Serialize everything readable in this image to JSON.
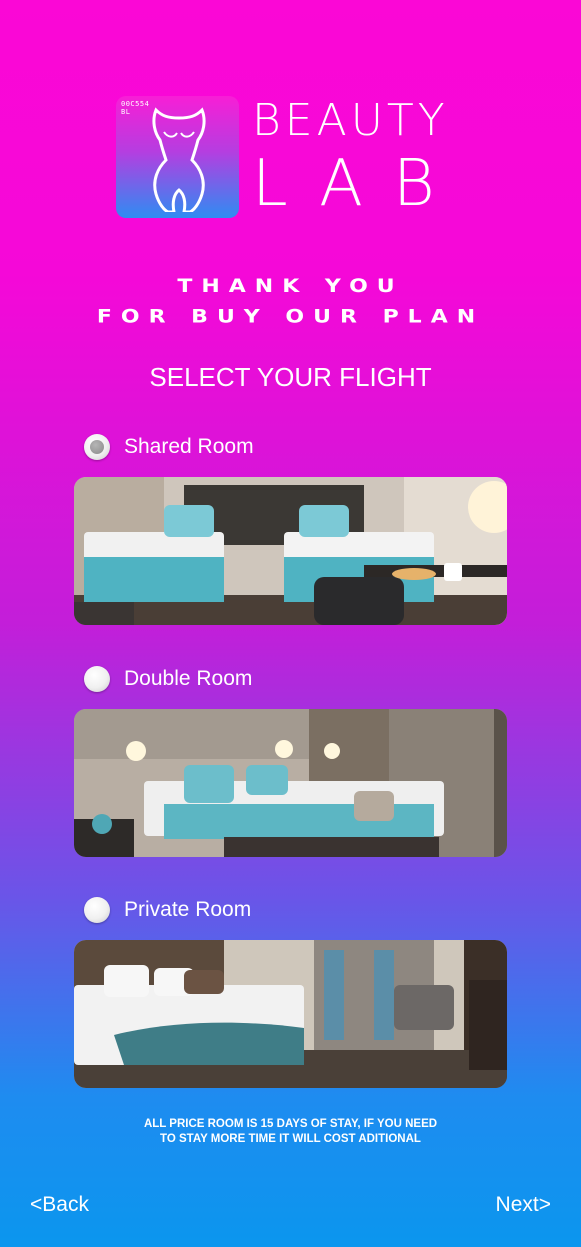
{
  "logo": {
    "code_top": "00C554",
    "code_bottom": "BL"
  },
  "brand": {
    "line1": "BEAUTY",
    "line2": "LAB"
  },
  "thanks": {
    "line1": "THANK YOU",
    "line2": "FOR BUY OUR PLAN"
  },
  "select_title": "SELECT YOUR FLIGHT",
  "options": [
    {
      "label": "Shared Room",
      "selected": true
    },
    {
      "label": "Double Room",
      "selected": false
    },
    {
      "label": "Private Room",
      "selected": false
    }
  ],
  "note": {
    "line1": "ALL PRICE ROOM IS 15 DAYS OF STAY, IF YOU NEED",
    "line2": "TO STAY MORE TIME IT WILL COST ADITIONAL"
  },
  "nav": {
    "back": "<Back",
    "next": "Next>"
  },
  "colors": {
    "top": "#fb07d6",
    "middle": "#c31ed9",
    "bottom": "#0b96ee"
  }
}
